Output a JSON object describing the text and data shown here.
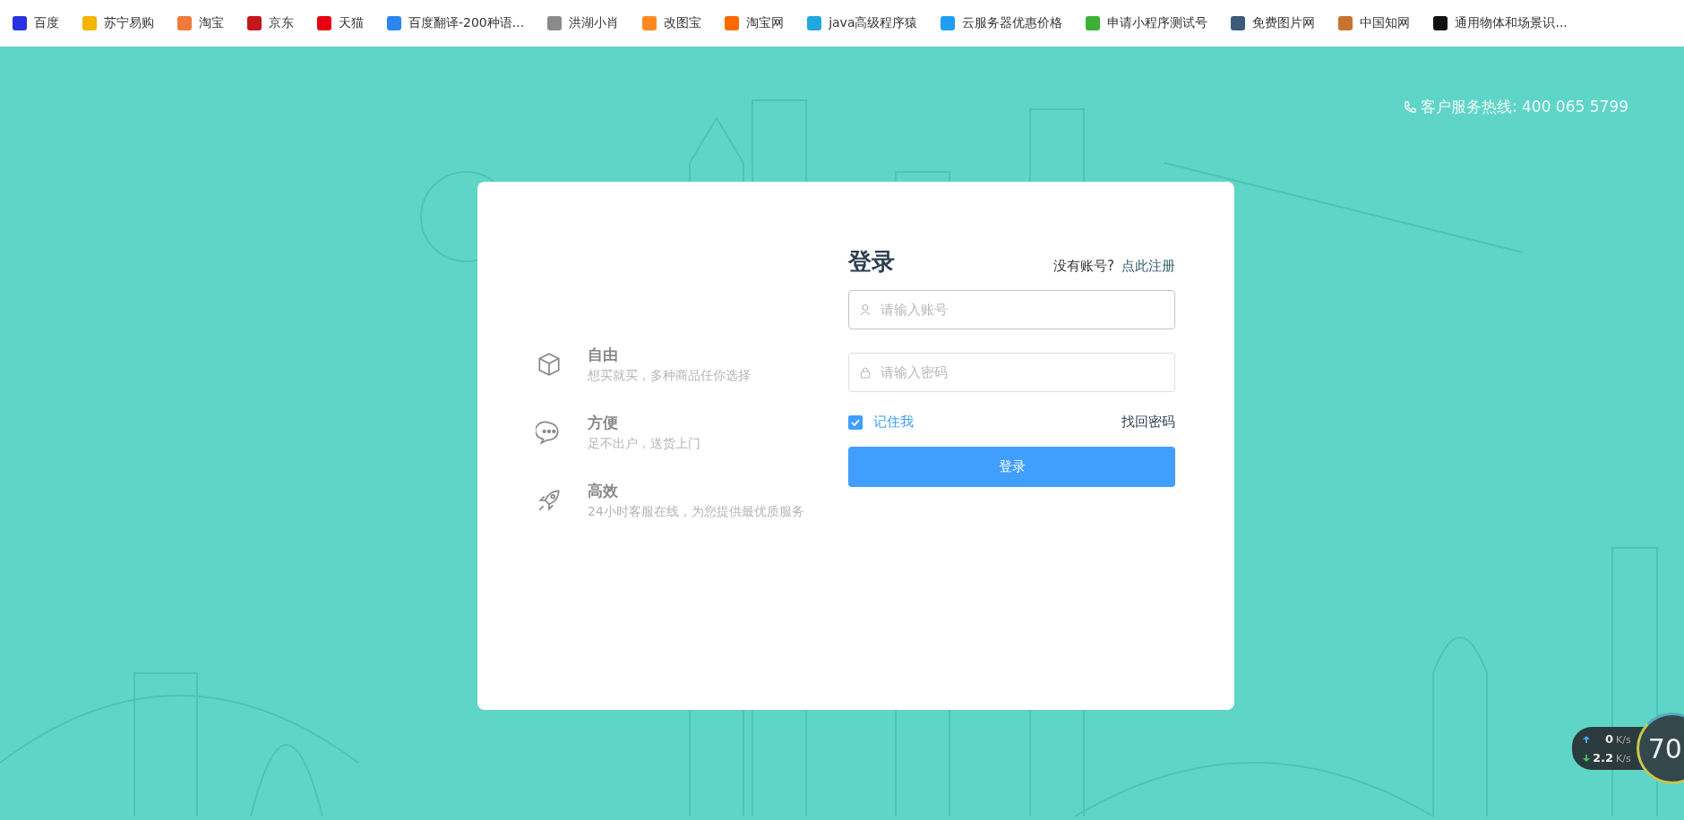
{
  "bookmarks": [
    {
      "label": "百度",
      "color": "#2932e1"
    },
    {
      "label": "苏宁易购",
      "color": "#f5b400"
    },
    {
      "label": "淘宝",
      "color": "#f07a3a"
    },
    {
      "label": "京东",
      "color": "#c4161c"
    },
    {
      "label": "天猫",
      "color": "#e60012"
    },
    {
      "label": "百度翻译-200种语...",
      "color": "#2c86f2"
    },
    {
      "label": "洪湖小肖",
      "color": "#8a8a8a"
    },
    {
      "label": "改图宝",
      "color": "#ff8a1f"
    },
    {
      "label": "淘宝网",
      "color": "#ff6a00"
    },
    {
      "label": "java高级程序猿",
      "color": "#20a8e0"
    },
    {
      "label": "云服务器优惠价格",
      "color": "#1e9ff2"
    },
    {
      "label": "申请小程序测试号",
      "color": "#3cb034"
    },
    {
      "label": "免费图片网",
      "color": "#3d5a78"
    },
    {
      "label": "中国知网",
      "color": "#c8742e"
    },
    {
      "label": "通用物体和场景识...",
      "color": "#111111"
    }
  ],
  "hotline": "客户服务热线: 400 065 5799",
  "features": [
    {
      "kind": "cube",
      "title": "自由",
      "text": "想买就买，多种商品任你选择"
    },
    {
      "kind": "chat",
      "title": "方便",
      "text": "足不出户，送货上门"
    },
    {
      "kind": "rocket",
      "title": "高效",
      "text": "24小时客服在线，为您提供最优质服务"
    }
  ],
  "login": {
    "title": "登录",
    "no_account": "没有账号?",
    "register": "点此注册",
    "account": {
      "placeholder": "请输入账号"
    },
    "password": {
      "placeholder": "请输入密码"
    },
    "remember": {
      "label": "记住我",
      "checked": true
    },
    "forgot": "找回密码",
    "submit": "登录"
  },
  "speed": {
    "up": "0",
    "up_unit": "K/s",
    "down": "2.2",
    "down_unit": "K/s",
    "gauge": "70"
  }
}
